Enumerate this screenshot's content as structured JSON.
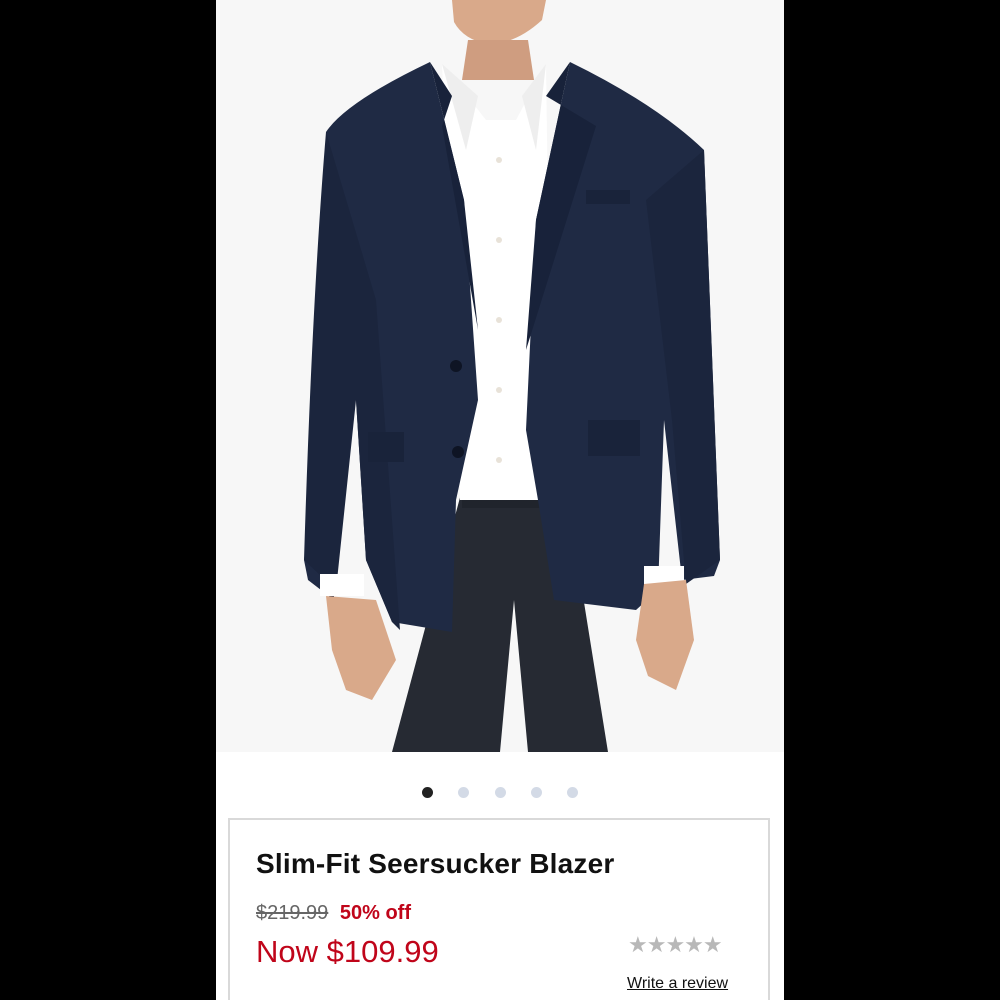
{
  "product": {
    "title": "Slim-Fit Seersucker Blazer",
    "original_price": "$219.99",
    "discount": "50% off",
    "sale_price": "Now $109.99",
    "rating_stars": "★★★★★",
    "rating_value": 0,
    "write_review_label": "Write a review"
  },
  "carousel": {
    "image_count": 5,
    "active_index": 0
  },
  "colors": {
    "sale_red": "#c0051a",
    "jacket_navy": "#1f2a44",
    "dot_inactive": "#d3dae6",
    "dot_active": "#222222"
  }
}
